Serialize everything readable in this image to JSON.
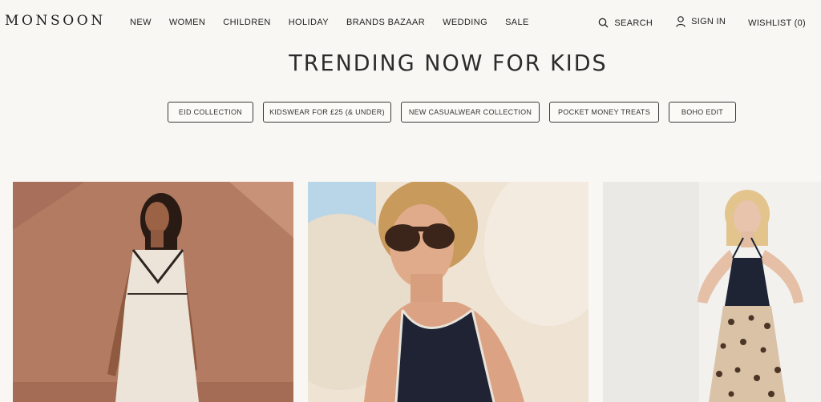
{
  "header": {
    "logo": "MONSOON",
    "nav": [
      "NEW",
      "WOMEN",
      "CHILDREN",
      "HOLIDAY",
      "BRANDS BAZAAR",
      "WEDDING",
      "SALE"
    ],
    "search_label": "SEARCH",
    "signin_label": "SIGN IN",
    "wishlist_label": "WISHLIST (0)"
  },
  "main": {
    "title": "TRENDING NOW FOR KIDS",
    "pills": [
      "EID COLLECTION",
      "KIDSWEAR FOR £25 (& UNDER)",
      "NEW CASUALWEAR COLLECTION",
      "POCKET MONEY TREATS",
      "BOHO EDIT"
    ]
  },
  "products": [
    {
      "image": "woman in white lace slip dress against terracotta wall"
    },
    {
      "image": "woman in sunglasses and navy tank top on sand"
    },
    {
      "image": "woman in navy halter top and leopard print skirt"
    }
  ],
  "colors": {
    "background": "#f9f7f3",
    "text": "#222222"
  }
}
